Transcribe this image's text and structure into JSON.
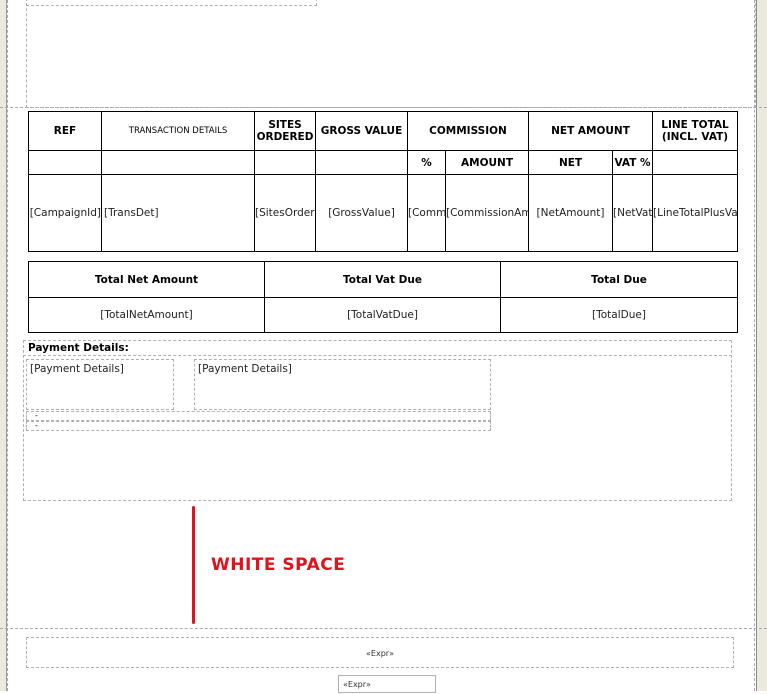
{
  "line_items": {
    "headers": {
      "ref": "REF",
      "transaction_details": "TRANSACTION DETAILS",
      "sites_ordered": "SITES ORDERED",
      "gross_value": "GROSS VALUE",
      "commission": "COMMISSION",
      "net_amount": "NET AMOUNT",
      "line_total": "LINE TOTAL (INCL. VAT)",
      "commission_pct": "%",
      "commission_amount": "AMOUNT",
      "net": "NET",
      "vat_pct": "VAT %"
    },
    "row": {
      "ref": "[CampaignId]",
      "transaction_details": "[TransDet]",
      "sites_ordered": "[SitesOrdered]",
      "gross_value": "[GrossValue]",
      "commission_pct": "[CommissionPc]",
      "commission_amount": "[CommissionAmount]",
      "net_amount": "[NetAmount]",
      "vat_pct": "[NetVatPercent]",
      "line_total": "[LineTotalPlusVat]"
    }
  },
  "totals": {
    "headers": {
      "total_net": "Total Net Amount",
      "total_vat": "Total Vat Due",
      "total_due": "Total Due"
    },
    "values": {
      "total_net": "[TotalNetAmount]",
      "total_vat": "[TotalVatDue]",
      "total_due": "[TotalDue]"
    }
  },
  "payment": {
    "title": "Payment Details:",
    "field_1": "[Payment Details]",
    "field_2": "[Payment Details]",
    "dash_1": "-",
    "dash_2": "-"
  },
  "annotation": {
    "label": "WHITE SPACE",
    "color": "#e0121c"
  },
  "footer": {
    "expr_1": "«Expr»",
    "expr_2": "«Expr»"
  }
}
